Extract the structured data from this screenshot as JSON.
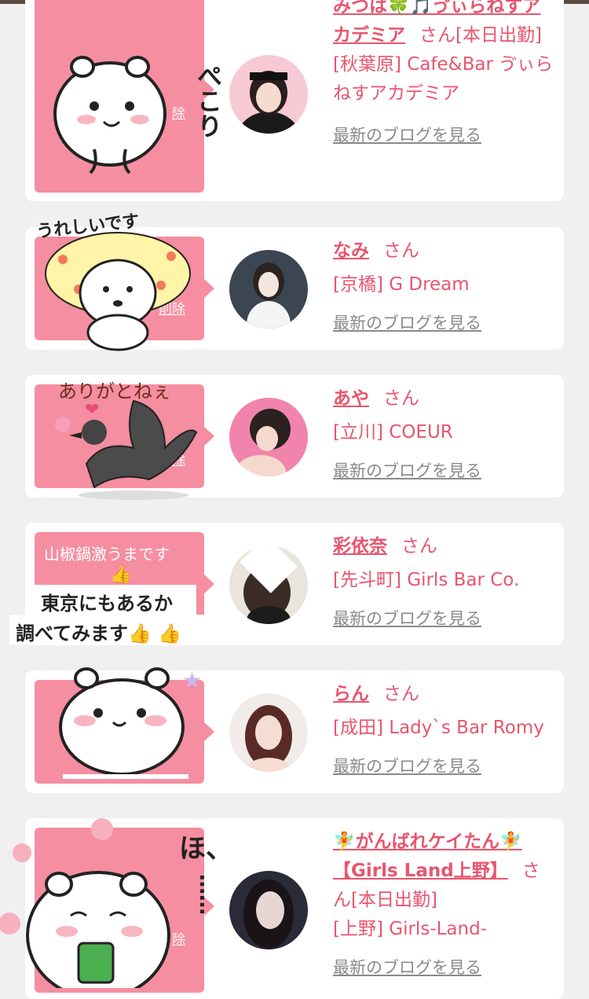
{
  "entries": [
    {
      "name": "みつは🍀🎵ゔぃらねすアカデミア",
      "san": "さん",
      "status": "[本日出勤]",
      "shop": "[秋葉原] Cafe&Bar ゔぃらねすアカデミア",
      "blog": "最新のブログを見る"
    },
    {
      "name": "なみ",
      "san": "さん",
      "shop": "[京橋] G Dream",
      "blog": "最新のブログを見る"
    },
    {
      "name": "あや",
      "san": "さん",
      "shop": "[立川] COEUR",
      "blog": "最新のブログを見る"
    },
    {
      "name": "彩依奈",
      "san": "さん",
      "shop": "[先斗町] Girls Bar Co.",
      "blog": "最新のブログを見る"
    },
    {
      "name": "らん",
      "san": "さん",
      "shop": "[成田] Lady`s Bar Romy",
      "blog": "最新のブログを見る"
    },
    {
      "name": "🧚がんばれケイたん🧚【Girls Land上野】",
      "san": "さん",
      "status": "[本日出勤]",
      "shop": "[上野] Girls-Land-",
      "blog": "最新のブログを見る"
    }
  ],
  "bubbles": {
    "b4_text": "山椒鍋激うまです",
    "b1_delete": "除",
    "b2_delete": "削除",
    "b3_delete": "除",
    "b6_delete": "除"
  },
  "stickers": {
    "s1_text": "ぺこり",
    "s2_text": "うれしいです",
    "s3_text": "ありがとねぇ",
    "s4_line1": "東京にもあるか",
    "s4_line2": "調べてみます👍 👍",
    "s6_text": "ほ、",
    "s6_dots": "……"
  },
  "colors": {
    "pink_text": "#e8556e",
    "bubble": "#f58ea0",
    "gray_link": "#8a8a8a",
    "background": "#f0f0f0"
  }
}
